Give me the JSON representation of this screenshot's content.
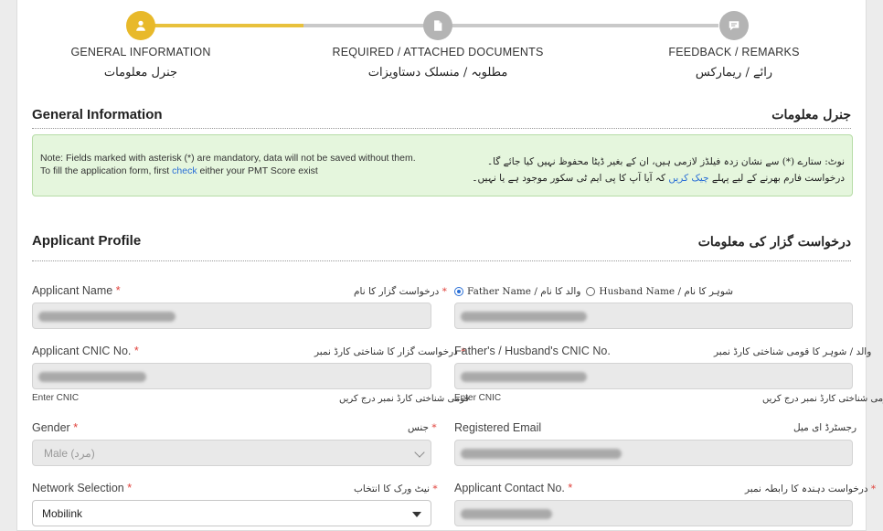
{
  "stepper": {
    "steps": [
      {
        "en": "GENERAL INFORMATION",
        "ur": "جنرل معلومات",
        "icon": "user-icon",
        "state": "active"
      },
      {
        "en": "REQUIRED / ATTACHED DOCUMENTS",
        "ur": "مطلوبہ / منسلک دستاویزات",
        "icon": "document-icon",
        "state": "pending"
      },
      {
        "en": "FEEDBACK / REMARKS",
        "ur": "رائے / ریمارکس",
        "icon": "chat-icon",
        "state": "pending"
      }
    ],
    "colors": {
      "active": "#e8b92a",
      "pending": "#b4b4b4"
    }
  },
  "general": {
    "title_en": "General Information",
    "title_ur": "جنرل معلومات",
    "note": {
      "en_line1": "Note: Fields marked with asterisk (*) are mandatory, data will not be saved without them.",
      "en_line2_pre": "To fill the application form, first ",
      "en_link": "check",
      "en_line2_post": " either your PMT Score exist",
      "ur_line1": "نوٹ: ستارے (*) سے نشان زدہ فیلڈز لازمی ہیں، ان کے بغیر ڈیٹا محفوظ نہیں کیا جائے گا۔",
      "ur_line2_pre": "درخواست فارم بھرنے کے لیے پہلے ",
      "ur_link": "چیک کریں",
      "ur_line2_post": " کہ آیا آپ کا پی ایم ٹی سکور موجود ہے یا نہیں۔"
    }
  },
  "profile": {
    "title_en": "Applicant Profile",
    "title_ur": "درخواست گزار کی معلومات",
    "applicant_name": {
      "label_en": "Applicant Name",
      "label_ur": "درخواست گزار کا نام"
    },
    "relation": {
      "father_label": "Father Name / والد کا نام",
      "husband_label": "Husband Name / شوہر کا نام",
      "selected": "Father Name"
    },
    "applicant_cnic": {
      "label_en": "Applicant CNIC No.",
      "label_ur": "درخواست گزار کا شناختی کارڈ نمبر",
      "hint_en": "Enter CNIC",
      "hint_ur": "قومی شناختی کارڈ نمبر درج کریں"
    },
    "father_cnic": {
      "label_en": "Father's / Husband's CNIC No.",
      "label_ur": "والد / شوہر کا قومی شناختی کارڈ نمبر",
      "hint_en": "Enter CNIC",
      "hint_ur": "قومی شناختی کارڈ نمبر درج کریں"
    },
    "gender": {
      "label_en": "Gender",
      "label_ur": "جنس",
      "value": "Male (مرد)"
    },
    "email": {
      "label_en": "Registered Email",
      "label_ur": "رجسٹرڈ ای میل"
    },
    "network": {
      "label_en": "Network Selection",
      "label_ur": "نیٹ ورک کا انتخاب",
      "value": "Mobilink"
    },
    "contact": {
      "label_en": "Applicant Contact No.",
      "label_ur": "درخواست دہندہ کا رابطہ نمبر"
    },
    "required_mark": "*"
  }
}
